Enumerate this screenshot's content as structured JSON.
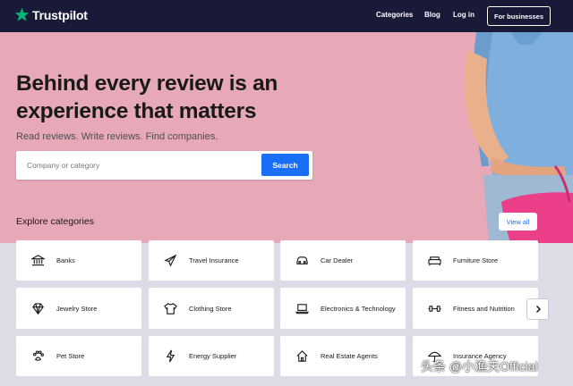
{
  "header": {
    "logo_text": "Trustpilot",
    "nav": [
      "Categories",
      "Blog",
      "Log in"
    ],
    "business_button": "For businesses"
  },
  "hero": {
    "title_line1": "Behind every review is an",
    "title_line2": "experience that matters",
    "subtitle": "Read reviews. Write reviews. Find companies.",
    "search_placeholder": "Company or category",
    "search_button": "Search"
  },
  "categories": {
    "heading": "Explore categories",
    "view_all": "View all",
    "items": [
      {
        "label": "Banks",
        "icon": "bank-icon"
      },
      {
        "label": "Travel Insurance",
        "icon": "airplane-icon"
      },
      {
        "label": "Car Dealer",
        "icon": "car-icon"
      },
      {
        "label": "Furniture Store",
        "icon": "sofa-icon"
      },
      {
        "label": "Jewelry Store",
        "icon": "diamond-icon"
      },
      {
        "label": "Clothing Store",
        "icon": "shirt-icon"
      },
      {
        "label": "Electronics & Technology",
        "icon": "laptop-icon"
      },
      {
        "label": "Fitness and Nutrition",
        "icon": "dumbbell-icon"
      },
      {
        "label": "Pet Store",
        "icon": "paw-icon"
      },
      {
        "label": "Energy Supplier",
        "icon": "lightning-icon"
      },
      {
        "label": "Real Estate Agents",
        "icon": "house-icon"
      },
      {
        "label": "Insurance Agency",
        "icon": "umbrella-icon"
      }
    ]
  },
  "watermark": "头条 @小渔夫Official",
  "colors": {
    "header_bg": "#191938",
    "hero_bg": "#e7a9b7",
    "brand_green": "#00b67a",
    "search_button": "#1a6ff7",
    "page_bg": "#dcdce6"
  }
}
